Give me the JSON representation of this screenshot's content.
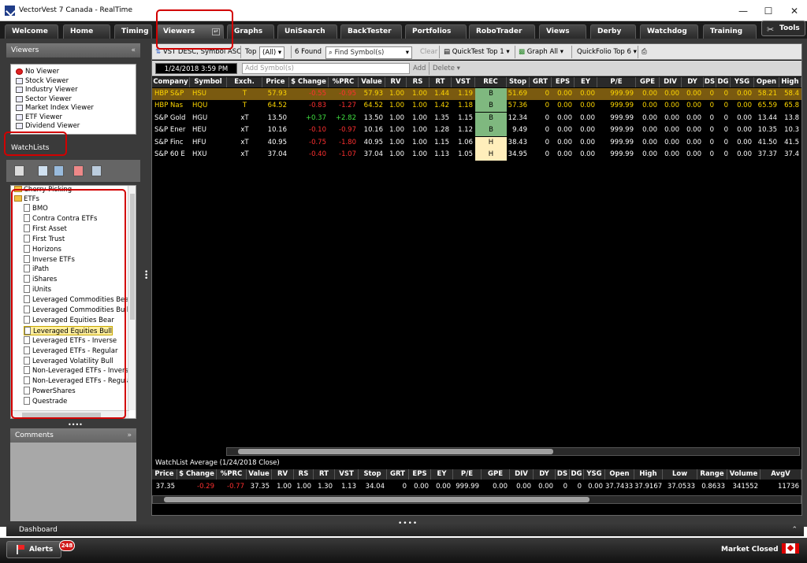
{
  "window": {
    "title": "VectorVest 7 Canada - RealTime",
    "min": "—",
    "max": "☐",
    "close": "✕"
  },
  "tabs": [
    {
      "label": "Welcome"
    },
    {
      "label": "Home"
    },
    {
      "label": "Timing"
    },
    {
      "label": "Viewers"
    },
    {
      "label": "Graphs"
    },
    {
      "label": "UniSearch"
    },
    {
      "label": "BackTester"
    },
    {
      "label": "Portfolios"
    },
    {
      "label": "RoboTrader"
    },
    {
      "label": "Views"
    },
    {
      "label": "Derby"
    },
    {
      "label": "Watchdog"
    },
    {
      "label": "Training"
    }
  ],
  "tools_label": "Tools",
  "viewers": {
    "header": "Viewers",
    "items": [
      "No Viewer",
      "Stock Viewer",
      "Industry Viewer",
      "Sector Viewer",
      "Market Index Viewer",
      "ETF Viewer",
      "Dividend Viewer"
    ]
  },
  "watchlists": {
    "header": "WatchLists",
    "root1": "Cherry Picking",
    "root2": "ETFs",
    "items": [
      "BMO",
      "Contra Contra ETFs",
      "First Asset",
      "First Trust",
      "Horizons",
      "Inverse ETFs",
      "iPath",
      "iShares",
      "iUnits",
      "Leveraged Commodities Bear",
      "Leveraged Commodities Bull",
      "Leveraged Equities Bear",
      "Leveraged Equities Bull",
      "Leveraged ETFs - Inverse",
      "Leveraged ETFs - Regular",
      "Leveraged Volatility Bull",
      "Non-Leveraged ETFs - Inverse",
      "Non-Leveraged ETFs - Regular",
      "PowerShares",
      "Questrade"
    ],
    "selected": "Leveraged Equities Bull"
  },
  "comments_header": "Comments",
  "toolbar": {
    "sort": "VST DESC, Symbol ASC",
    "top_label": "Top",
    "top_value": "(All)",
    "found": "6 Found",
    "find_placeholder": "Find Symbol(s)",
    "clear": "Clear",
    "quicktest": "QuickTest Top 1",
    "graph": "Graph All",
    "quickfolio": "QuickFolio Top 6"
  },
  "toolbar2": {
    "date": "1/24/2018 3:59 PM",
    "add_placeholder": "Add Symbol(s)",
    "add": "Add",
    "delete": "Delete"
  },
  "grid": {
    "columns": [
      "Company",
      "Symbol",
      "Exch.",
      "Price",
      "$ Change",
      "%PRC",
      "Value",
      "RV",
      "RS",
      "RT",
      "VST",
      "REC",
      "Stop",
      "GRT",
      "EPS",
      "EY",
      "P/E",
      "GPE",
      "DIV",
      "DY",
      "DS",
      "DG",
      "YSG",
      "Open",
      "High"
    ],
    "rows": [
      [
        "HBP S&P",
        "HSU",
        "T",
        "57.93",
        "-0.55",
        "-0.95",
        "57.93",
        "1.00",
        "1.00",
        "1.44",
        "1.19",
        "B",
        "51.69",
        "0",
        "0.00",
        "0.00",
        "999.99",
        "0.00",
        "0.00",
        "0.00",
        "0",
        "0",
        "0.00",
        "58.21",
        "58.4"
      ],
      [
        "HBP Nas",
        "HQU",
        "T",
        "64.52",
        "-0.83",
        "-1.27",
        "64.52",
        "1.00",
        "1.00",
        "1.42",
        "1.18",
        "B",
        "57.36",
        "0",
        "0.00",
        "0.00",
        "999.99",
        "0.00",
        "0.00",
        "0.00",
        "0",
        "0",
        "0.00",
        "65.59",
        "65.8"
      ],
      [
        "S&P Gold",
        "HGU",
        "xT",
        "13.50",
        "+0.37",
        "+2.82",
        "13.50",
        "1.00",
        "1.00",
        "1.35",
        "1.15",
        "B",
        "12.34",
        "0",
        "0.00",
        "0.00",
        "999.99",
        "0.00",
        "0.00",
        "0.00",
        "0",
        "0",
        "0.00",
        "13.44",
        "13.8"
      ],
      [
        "S&P Ener",
        "HEU",
        "xT",
        "10.16",
        "-0.10",
        "-0.97",
        "10.16",
        "1.00",
        "1.00",
        "1.28",
        "1.12",
        "B",
        "9.49",
        "0",
        "0.00",
        "0.00",
        "999.99",
        "0.00",
        "0.00",
        "0.00",
        "0",
        "0",
        "0.00",
        "10.35",
        "10.3"
      ],
      [
        "S&P Finc",
        "HFU",
        "xT",
        "40.95",
        "-0.75",
        "-1.80",
        "40.95",
        "1.00",
        "1.00",
        "1.15",
        "1.06",
        "H",
        "38.43",
        "0",
        "0.00",
        "0.00",
        "999.99",
        "0.00",
        "0.00",
        "0.00",
        "0",
        "0",
        "0.00",
        "41.50",
        "41.5"
      ],
      [
        "S&P 60 E",
        "HXU",
        "xT",
        "37.04",
        "-0.40",
        "-1.07",
        "37.04",
        "1.00",
        "1.00",
        "1.13",
        "1.05",
        "H",
        "34.95",
        "0",
        "0.00",
        "0.00",
        "999.99",
        "0.00",
        "0.00",
        "0.00",
        "0",
        "0",
        "0.00",
        "37.37",
        "37.4"
      ]
    ]
  },
  "average": {
    "title": "WatchList Average (1/24/2018 Close)",
    "columns": [
      "Price",
      "$ Change",
      "%PRC",
      "Value",
      "RV",
      "RS",
      "RT",
      "VST",
      "Stop",
      "GRT",
      "EPS",
      "EY",
      "P/E",
      "GPE",
      "DIV",
      "DY",
      "DS",
      "DG",
      "YSG",
      "Open",
      "High",
      "Low",
      "Range",
      "Volume",
      "AvgV"
    ],
    "values": [
      "37.35",
      "-0.29",
      "-0.77",
      "37.35",
      "1.00",
      "1.00",
      "1.30",
      "1.13",
      "34.04",
      "0",
      "0.00",
      "0.00",
      "999.99",
      "0.00",
      "0.00",
      "0.00",
      "0",
      "0",
      "0.00",
      "37.7433",
      "37.9167",
      "37.0533",
      "0.8633",
      "341552",
      "11736"
    ]
  },
  "dashboard": "Dashboard",
  "alerts": {
    "label": "Alerts",
    "count": "248"
  },
  "market_status": "Market Closed"
}
